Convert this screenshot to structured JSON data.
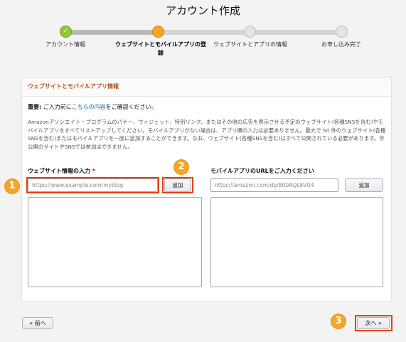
{
  "page": {
    "title": "アカウント作成"
  },
  "stepper": {
    "steps": [
      {
        "label": "アカウント情報",
        "state": "complete"
      },
      {
        "label": "ウェブサイトとモバイルアプリの登録",
        "state": "current"
      },
      {
        "label": "ウェブサイトとアプリの情報",
        "state": "pending"
      },
      {
        "label": "お申し込み完了",
        "state": "pending"
      }
    ],
    "complete_mark": "✓"
  },
  "section": {
    "title": "ウェブサイトとモバイルアプリ情報",
    "important_label": "重要:",
    "important_pre": " ご入力前に",
    "important_link": "こちらの内容",
    "important_post": "をご確認ください。",
    "description": "Amazonアソシエイト・プログラムのバナー、ウィジェット、特別リンク、またはその他の広告を表示させる予定のウェブサイト(各種SNSを含む)やモバイルアプリをすべてリストアップしてください。モバイルアプリがない場合は、アプリ欄の入力は必要ありません。最大で 50 件のウェブサイト(各種SNSを含む)またはモバイルアプリを一度に追加することができます。なお、ウェブサイト(各種SNSを含む)はすべて公開されている必要があります。非公開のサイトやSNSでは参加はできません。"
  },
  "website": {
    "label": "ウェブサイト情報の入力",
    "required_mark": "*",
    "placeholder": "https://www.example.com/myblog",
    "add_label": "追加"
  },
  "app": {
    "label": "モバイルアプリのURLをご入力ください",
    "placeholder": "https://amazon.com/dp/B00AQL8VU4",
    "add_label": "追加"
  },
  "nav": {
    "prev_icon": "«",
    "prev_label": "前へ",
    "next_label": "次へ",
    "next_icon": "»"
  },
  "annotations": {
    "badge1": "1",
    "badge2": "2",
    "badge3": "3"
  },
  "colors": {
    "accent": "#f5a623",
    "highlight": "#e8400e",
    "link": "#0066c0",
    "section_title": "#b3541e",
    "step_complete": "#8fc93a"
  }
}
